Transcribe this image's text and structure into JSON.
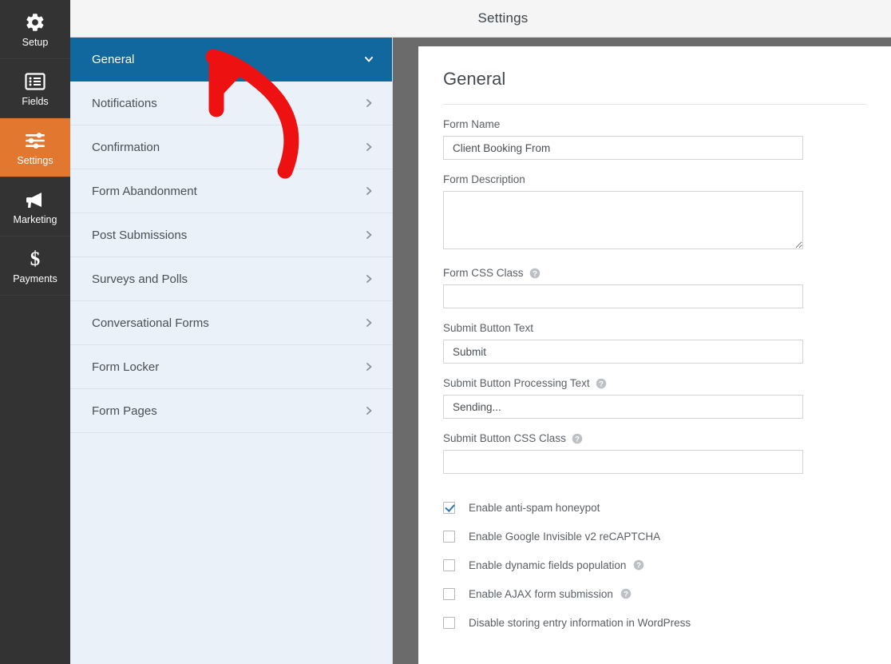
{
  "header": {
    "title": "Settings"
  },
  "rail": {
    "items": [
      {
        "label": "Setup",
        "icon": "gear-icon",
        "active": false
      },
      {
        "label": "Fields",
        "icon": "list-icon",
        "active": false
      },
      {
        "label": "Settings",
        "icon": "sliders-icon",
        "active": true
      },
      {
        "label": "Marketing",
        "icon": "megaphone-icon",
        "active": false
      },
      {
        "label": "Payments",
        "icon": "dollar-icon",
        "active": false
      }
    ]
  },
  "menu": {
    "items": [
      {
        "label": "General",
        "active": true,
        "chevron": "chevron-down-icon"
      },
      {
        "label": "Notifications",
        "active": false,
        "chevron": "chevron-right-icon"
      },
      {
        "label": "Confirmation",
        "active": false,
        "chevron": "chevron-right-icon"
      },
      {
        "label": "Form Abandonment",
        "active": false,
        "chevron": "chevron-right-icon"
      },
      {
        "label": "Post Submissions",
        "active": false,
        "chevron": "chevron-right-icon"
      },
      {
        "label": "Surveys and Polls",
        "active": false,
        "chevron": "chevron-right-icon"
      },
      {
        "label": "Conversational Forms",
        "active": false,
        "chevron": "chevron-right-icon"
      },
      {
        "label": "Form Locker",
        "active": false,
        "chevron": "chevron-right-icon"
      },
      {
        "label": "Form Pages",
        "active": false,
        "chevron": "chevron-right-icon"
      }
    ]
  },
  "panel": {
    "title": "General",
    "fields": {
      "form_name": {
        "label": "Form Name",
        "value": "Client Booking From",
        "placeholder": "",
        "help": false
      },
      "form_description": {
        "label": "Form Description",
        "value": "",
        "placeholder": "",
        "help": false
      },
      "form_css_class": {
        "label": "Form CSS Class",
        "value": "",
        "placeholder": "",
        "help": true
      },
      "submit_text": {
        "label": "Submit Button Text",
        "value": "Submit",
        "placeholder": "",
        "help": false
      },
      "submit_processing": {
        "label": "Submit Button Processing Text",
        "value": "Sending...",
        "placeholder": "",
        "help": true
      },
      "submit_css_class": {
        "label": "Submit Button CSS Class",
        "value": "",
        "placeholder": "",
        "help": true
      }
    },
    "checkboxes": [
      {
        "label": "Enable anti-spam honeypot",
        "checked": true,
        "help": false
      },
      {
        "label": "Enable Google Invisible v2 reCAPTCHA",
        "checked": false,
        "help": false
      },
      {
        "label": "Enable dynamic fields population",
        "checked": false,
        "help": true
      },
      {
        "label": "Enable AJAX form submission",
        "checked": false,
        "help": true
      },
      {
        "label": "Disable storing entry information in WordPress",
        "checked": false,
        "help": false
      }
    ]
  },
  "annotation": {
    "name": "red-arrow",
    "color": "#ee1111",
    "points_at": "General"
  },
  "colors": {
    "rail_bg": "#333333",
    "rail_active": "#e27730",
    "menu_bg": "#eaf1f8",
    "menu_active": "#11689f",
    "gutter": "#6b6b6b",
    "accent_check": "#2a78b6"
  }
}
